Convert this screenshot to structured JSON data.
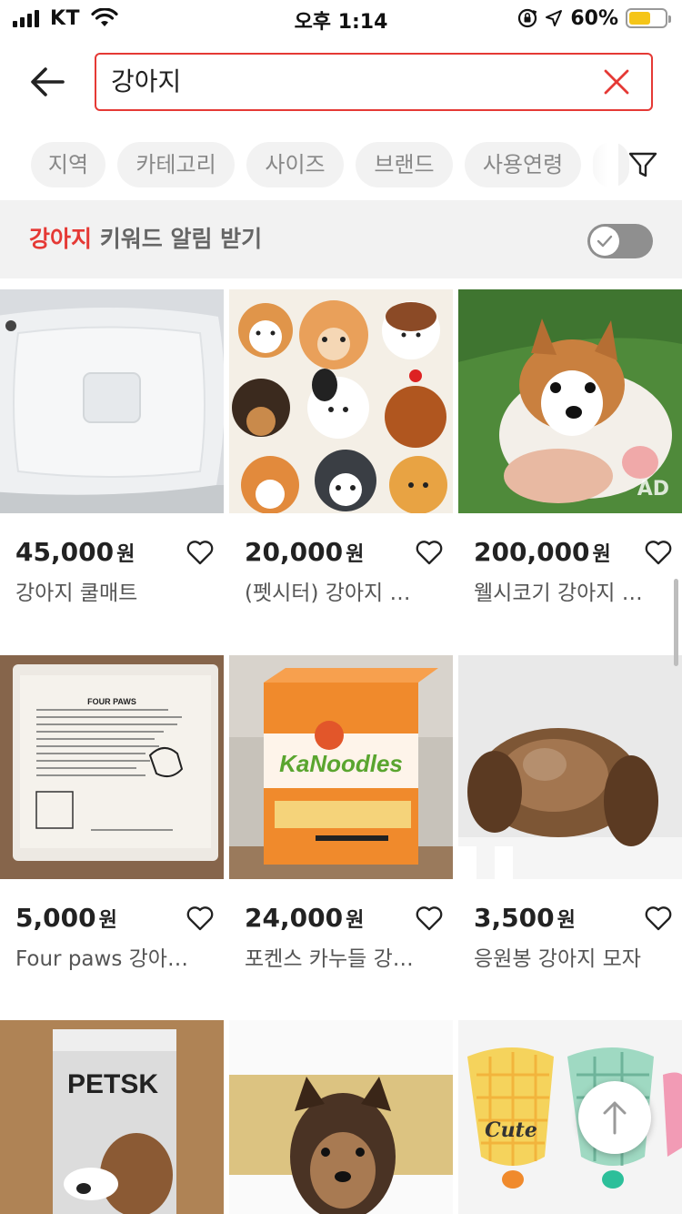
{
  "status_bar": {
    "carrier": "KT",
    "time": "오후 1:14",
    "battery_percent": "60%",
    "battery_level": 0.6,
    "icons": [
      "signal-icon",
      "wifi-icon",
      "rotation-lock-icon",
      "location-icon",
      "battery-icon"
    ]
  },
  "search": {
    "back_icon": "back-arrow-icon",
    "query": "강아지",
    "clear_icon": "close-icon",
    "accent_color": "#e53935"
  },
  "filters": {
    "chips": [
      "지역",
      "카테고리",
      "사이즈",
      "브랜드",
      "사용연령"
    ],
    "filter_icon": "funnel-icon"
  },
  "keyword_alert": {
    "keyword": "강아지",
    "label": "키워드 알림 받기",
    "toggle_on": false
  },
  "products": [
    {
      "price": "45,000",
      "unit": "원",
      "title": "강아지 쿨매트",
      "ad": ""
    },
    {
      "price": "20,000",
      "unit": "원",
      "title": "(펫시터) 강아지 돌보미",
      "ad": ""
    },
    {
      "price": "200,000",
      "unit": "원",
      "title": "웰시코기 강아지 분양",
      "ad": "AD"
    },
    {
      "price": "5,000",
      "unit": "원",
      "title": "Four paws 강아지 패드",
      "ad": ""
    },
    {
      "price": "24,000",
      "unit": "원",
      "title": "포켄스 카누들 강아지 간식",
      "ad": ""
    },
    {
      "price": "3,500",
      "unit": "원",
      "title": "응원봉 강아지 모자",
      "ad": ""
    },
    {
      "price": "",
      "unit": "",
      "title": "",
      "ad": ""
    },
    {
      "price": "",
      "unit": "",
      "title": "",
      "ad": ""
    },
    {
      "price": "",
      "unit": "",
      "title": "",
      "ad": ""
    }
  ],
  "thumb_texts": {
    "petsk_brand": "PETSK",
    "kanoodles_brand": "KaNoodles",
    "fourpaws_brand": "FOUR PAWS",
    "cute_label": "Cute"
  },
  "scroll_top_icon": "arrow-up-icon"
}
